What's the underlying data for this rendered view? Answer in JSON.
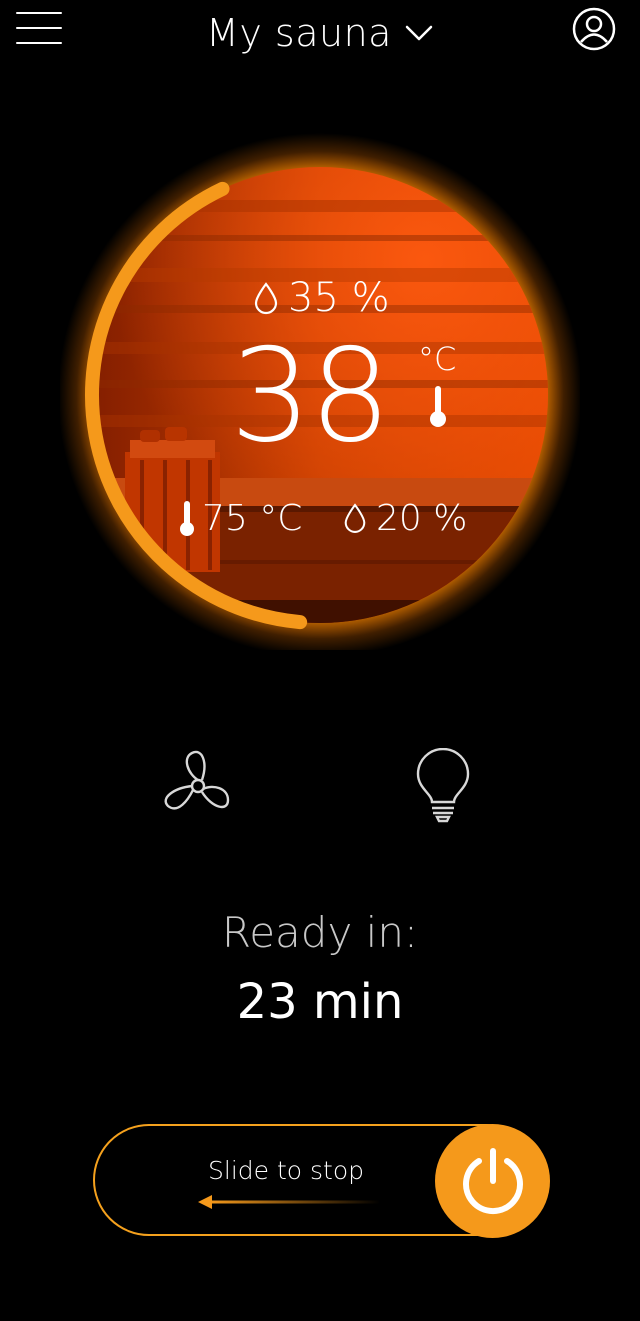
{
  "header": {
    "title": "My sauna",
    "menu_icon": "hamburger-menu-icon",
    "dropdown_icon": "chevron-down-icon",
    "profile_icon": "user-profile-icon"
  },
  "gauge": {
    "current_humidity": "35 %",
    "current_temperature": "38",
    "temperature_unit": "°C",
    "target_temperature": "75 °C",
    "target_humidity": "20 %",
    "progress_fraction": 0.42,
    "accent_color": "#f5991b"
  },
  "controls": {
    "fan_icon": "fan-icon",
    "light_icon": "light-bulb-icon"
  },
  "status": {
    "ready_label": "Ready in:",
    "ready_time": "23 min"
  },
  "slider": {
    "label": "Slide to stop",
    "power_icon": "power-icon"
  }
}
